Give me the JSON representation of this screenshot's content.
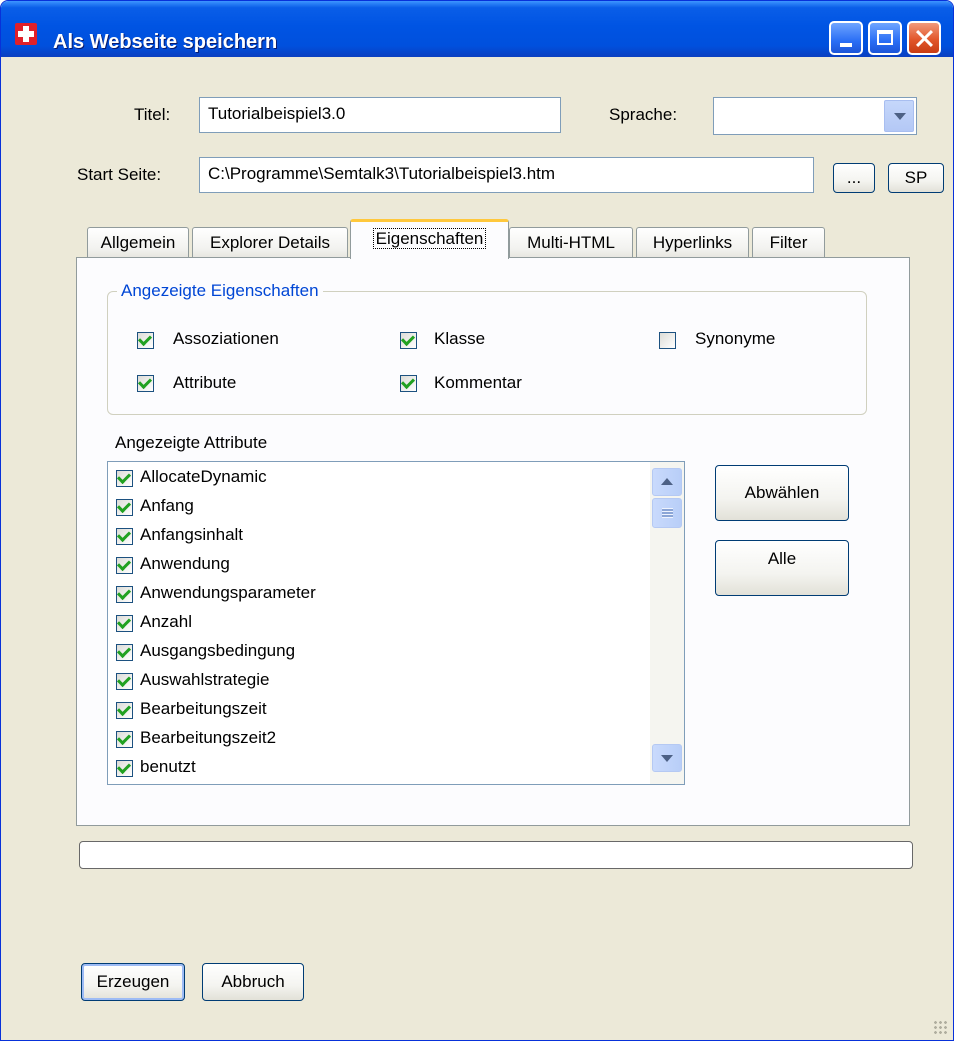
{
  "window": {
    "title": "Als Webseite speichern"
  },
  "form": {
    "title_label": "Titel:",
    "title_value": "Tutorialbeispiel3.0",
    "language_label": "Sprache:",
    "language_value": "",
    "start_label": "Start Seite:",
    "start_value": "C:\\Programme\\Semtalk3\\Tutorialbeispiel3.htm",
    "browse_button": "...",
    "sp_button": "SP"
  },
  "tabs": [
    {
      "label": "Allgemein",
      "active": false
    },
    {
      "label": "Explorer Details",
      "active": false
    },
    {
      "label": "Eigenschaften",
      "active": true
    },
    {
      "label": "Multi-HTML",
      "active": false
    },
    {
      "label": "Hyperlinks",
      "active": false
    },
    {
      "label": "Filter",
      "active": false
    }
  ],
  "properties": {
    "group_title": "Angezeigte Eigenschaften",
    "options": [
      {
        "label": "Assoziationen",
        "checked": true
      },
      {
        "label": "Klasse",
        "checked": true
      },
      {
        "label": "Synonyme",
        "checked": false
      },
      {
        "label": "Attribute",
        "checked": true
      },
      {
        "label": "Kommentar",
        "checked": true
      }
    ]
  },
  "attributes": {
    "label": "Angezeigte Attribute",
    "items": [
      {
        "label": "AllocateDynamic",
        "checked": true
      },
      {
        "label": "Anfang",
        "checked": true
      },
      {
        "label": "Anfangsinhalt",
        "checked": true
      },
      {
        "label": "Anwendung",
        "checked": true
      },
      {
        "label": "Anwendungsparameter",
        "checked": true
      },
      {
        "label": "Anzahl",
        "checked": true
      },
      {
        "label": "Ausgangsbedingung",
        "checked": true
      },
      {
        "label": "Auswahlstrategie",
        "checked": true
      },
      {
        "label": "Bearbeitungszeit",
        "checked": true
      },
      {
        "label": "Bearbeitungszeit2",
        "checked": true
      },
      {
        "label": "benutzt",
        "checked": true
      }
    ],
    "deselect_button": "Abwählen",
    "all_button": "Alle"
  },
  "progress": {
    "value": 0
  },
  "footer": {
    "create_button": "Erzeugen",
    "cancel_button": "Abbruch"
  },
  "colors": {
    "titlebar": "#0054e3",
    "window_face": "#ece9d8",
    "group_title": "#0046d5",
    "checkmark": "#21a121",
    "active_tab_highlight": "#ffc83c"
  }
}
